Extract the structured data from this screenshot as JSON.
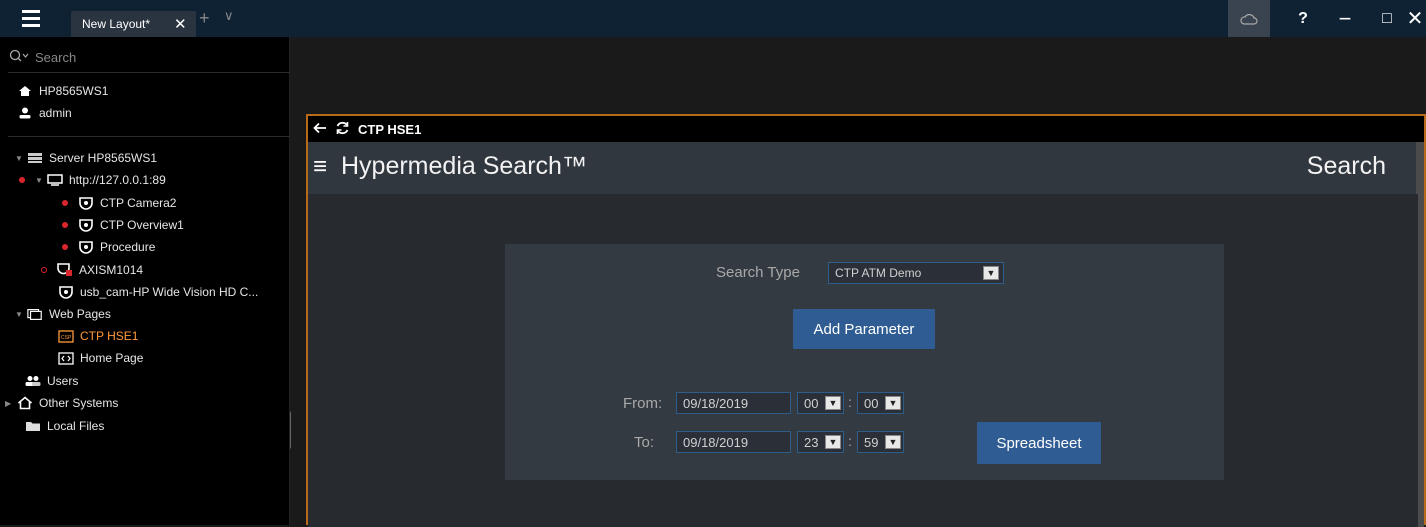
{
  "titlebar": {
    "tab_label": "New Layout*",
    "tab_close": "✕",
    "new_tab": "+",
    "tab_menu": "∨",
    "help": "?",
    "minimize": "−",
    "maximize": "□",
    "close": "✕"
  },
  "sidebar": {
    "search_placeholder": "Search",
    "host": "HP8565WS1",
    "user": "admin",
    "tree": {
      "server": "Server HP8565WS1",
      "recorder": "http://127.0.0.1:89",
      "cam1": "CTP Camera2",
      "cam2": "CTP Overview1",
      "cam3": "Procedure",
      "cam4": "AXISM1014",
      "cam5": "usb_cam-HP Wide Vision HD C...",
      "webpages": "Web Pages",
      "web1": "CTP HSE1",
      "web2": "Home Page",
      "users": "Users",
      "other": "Other Systems",
      "local": "Local Files"
    }
  },
  "frame": {
    "title": "CTP HSE1"
  },
  "app": {
    "title": "Hypermedia Search™",
    "right_title": "Search",
    "search_type_label": "Search Type",
    "search_type_value": "CTP ATM Demo",
    "add_parameter": "Add Parameter",
    "from_label": "From:",
    "from_date": "09/18/2019",
    "from_hour": "00",
    "from_min": "00",
    "to_label": "To:",
    "to_date": "09/18/2019",
    "to_hour": "23",
    "to_min": "59",
    "colon": ":",
    "spreadsheet": "Spreadsheet"
  }
}
